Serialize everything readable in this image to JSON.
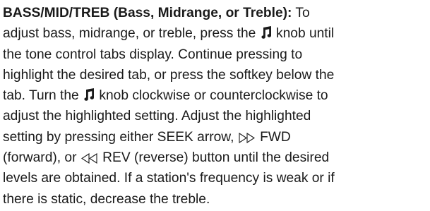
{
  "paragraph": {
    "term": "BASS/MID/TREB (Bass, Midrange, or Treble):",
    "l1_after_term": " To",
    "l2_before_knob": "adjust bass, midrange, or treble, press the ",
    "l2_after_knob": " knob until",
    "l3": "the tone control tabs display. Continue pressing to",
    "l4": "highlight the desired tab, or press the softkey below the",
    "l5_before_knob": "tab. Turn the ",
    "l5_after_knob": " knob clockwise or counterclockwise to",
    "l6": "adjust the highlighted setting. Adjust the highlighted",
    "l7_before_fwd": "setting by pressing either SEEK arrow, ",
    "l7_after_fwd": " FWD",
    "l8_before_rev": "(forward), or ",
    "l8_after_rev": " REV (reverse) button until the desired",
    "l9": "levels are obtained. If a station's frequency is weak or if",
    "l10": "there is static, decrease the treble."
  },
  "icons": {
    "tone_knob": "music-note-icon",
    "forward": "fast-forward-outline-icon",
    "reverse": "rewind-outline-icon"
  }
}
